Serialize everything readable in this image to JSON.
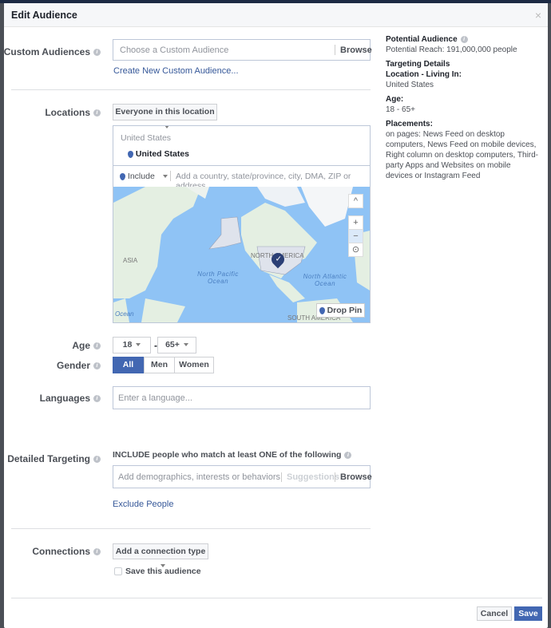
{
  "title": "Edit Audience",
  "close_label": "×",
  "custom_audiences": {
    "label": "Custom Audiences",
    "placeholder": "Choose a Custom Audience",
    "browse": "Browse",
    "create_link": "Create New Custom Audience..."
  },
  "locations": {
    "label": "Locations",
    "dropdown": "Everyone in this location",
    "group_title": "United States",
    "selected": "United States",
    "include": "Include",
    "placeholder": "Add a country, state/province, city, DMA, ZIP or address",
    "map": {
      "labels": [
        "ASIA",
        "NORTH AMERICA",
        "North Pacific Ocean",
        "North Atlantic Ocean",
        "SOUTH AMERICA",
        "Ocean"
      ],
      "zoom_in": "+",
      "zoom_out": "−",
      "collapse": "^",
      "drop_pin": "Drop Pin"
    }
  },
  "age": {
    "label": "Age",
    "min": "18",
    "separator": "-",
    "max": "65+"
  },
  "gender": {
    "label": "Gender",
    "options": [
      "All",
      "Men",
      "Women"
    ],
    "selected": "All"
  },
  "languages": {
    "label": "Languages",
    "placeholder": "Enter a language..."
  },
  "detailed": {
    "label": "Detailed Targeting",
    "include_text": "INCLUDE people who match at least ONE of the following",
    "placeholder": "Add demographics, interests or behaviors",
    "suggestions": "Suggestions",
    "browse": "Browse",
    "exclude_link": "Exclude People"
  },
  "connections": {
    "label": "Connections",
    "dropdown": "Add a connection type",
    "save_audience": "Save this audience",
    "save_checked": false
  },
  "summary": {
    "title": "Potential Audience",
    "reach": "Potential Reach: 191,000,000 people",
    "targeting_title": "Targeting Details",
    "location_title": "Location - Living In:",
    "location_value": "United States",
    "age_title": "Age:",
    "age_value": "18 - 65+",
    "placements_title": "Placements:",
    "placements_value": "on pages: News Feed on desktop computers, News Feed on mobile devices, Right column on desktop computers, Third-party Apps and Websites on mobile devices or Instagram Feed"
  },
  "footer": {
    "cancel": "Cancel",
    "save": "Save"
  },
  "colors": {
    "accent": "#4267b2",
    "link": "#365899",
    "map_water": "#8fc3f5"
  }
}
